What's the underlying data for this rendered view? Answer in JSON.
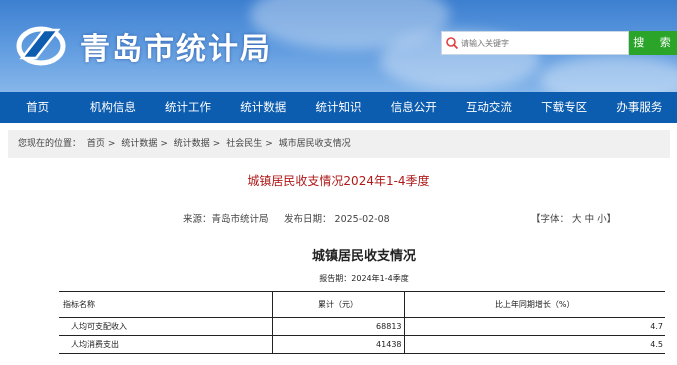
{
  "header": {
    "site_title": "青岛市统计局",
    "search_placeholder": "请输入关键字",
    "search_button": "搜 索"
  },
  "nav": [
    "首页",
    "机构信息",
    "统计工作",
    "统计数据",
    "统计知识",
    "信息公开",
    "互动交流",
    "下载专区",
    "办事服务"
  ],
  "breadcrumb": {
    "prefix": "您现在的位置：",
    "items": [
      "首页",
      "统计数据",
      "统计数据",
      "社会民生",
      "城市居民收支情况"
    ],
    "sep": ">"
  },
  "article": {
    "title": "城镇居民收支情况2024年1-4季度",
    "source": "来源：青岛市统计局",
    "date": "发布日期：  2025-02-08",
    "font_label": "【字体：",
    "font_sizes": [
      "大",
      "中",
      "小"
    ],
    "font_close": "】"
  },
  "document": {
    "title": "城镇居民收支情况",
    "period": "报告期：2024年1-4季度",
    "table": {
      "headers": [
        "指标名称",
        "累计（元）",
        "比上年同期增长（%）"
      ],
      "rows": [
        [
          "人均可支配收入",
          "68813",
          "4.7"
        ],
        [
          "人均消费支出",
          "41438",
          "4.5"
        ]
      ]
    }
  },
  "colors": {
    "nav_bg": "#0c5caf",
    "search_button": "#2aa52a",
    "title_red": "#b01818"
  }
}
